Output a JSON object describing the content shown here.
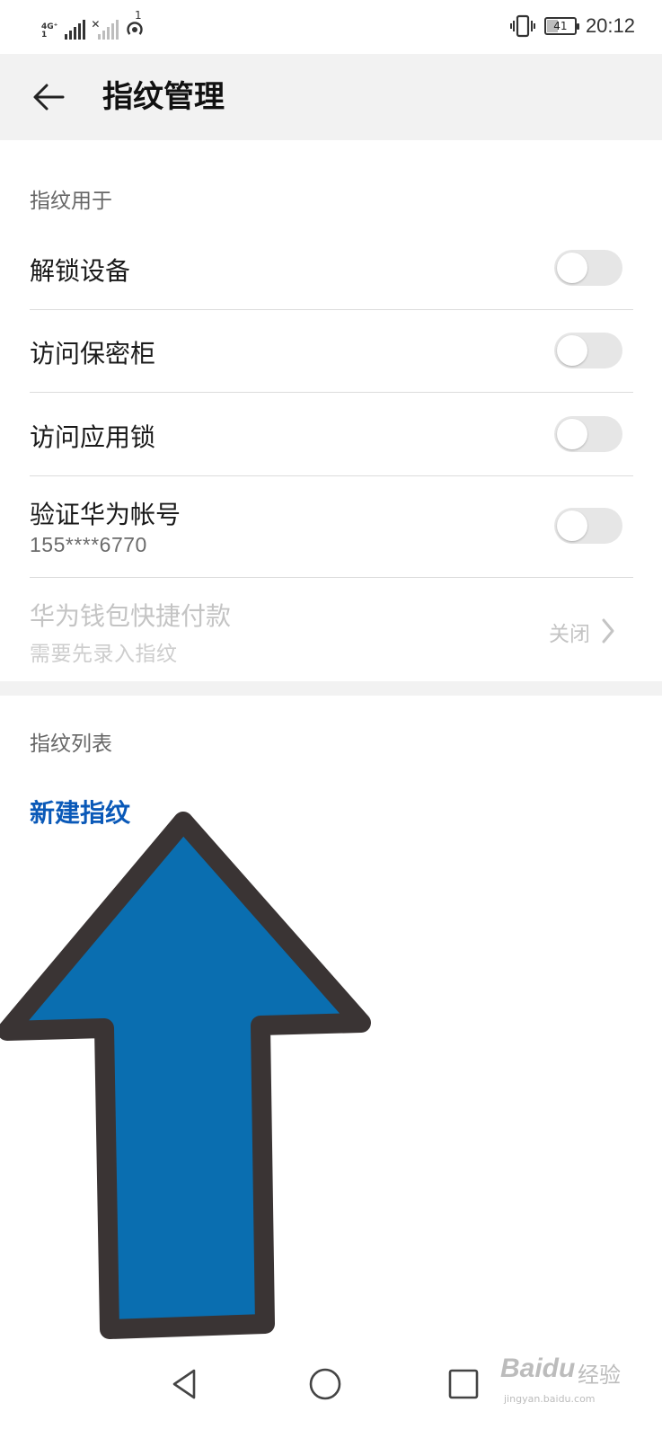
{
  "status_bar": {
    "network_type": "4G⁺",
    "network_sub": "1",
    "sim2_mark": "✕",
    "hotspot_badge": "1",
    "battery_level": "41",
    "battery_fraction": 0.41,
    "time": "20:12"
  },
  "app_bar": {
    "title": "指纹管理"
  },
  "section_usage": {
    "header": "指纹用于",
    "items": [
      {
        "label": "解锁设备",
        "toggle_on": false
      },
      {
        "label": "访问保密柜",
        "toggle_on": false
      },
      {
        "label": "访问应用锁",
        "toggle_on": false
      },
      {
        "label": "验证华为帐号",
        "sub": "155****6770",
        "toggle_on": false
      },
      {
        "label": "华为钱包快捷付款",
        "sub": "需要先录入指纹",
        "value": "关闭",
        "disabled": true
      }
    ]
  },
  "section_list": {
    "header": "指纹列表",
    "new_fingerprint": "新建指纹"
  },
  "annotation": {
    "arrow_color": "#0a6eb0",
    "arrow_outline": "#3a3434"
  },
  "watermark": {
    "brand": "Baidu",
    "cn": "经验",
    "url": "jingyan.baidu.com"
  },
  "colors": {
    "accent": "#0a59b8",
    "toggle_off": "#e6e6e6",
    "app_bar_bg": "#f2f2f2"
  }
}
